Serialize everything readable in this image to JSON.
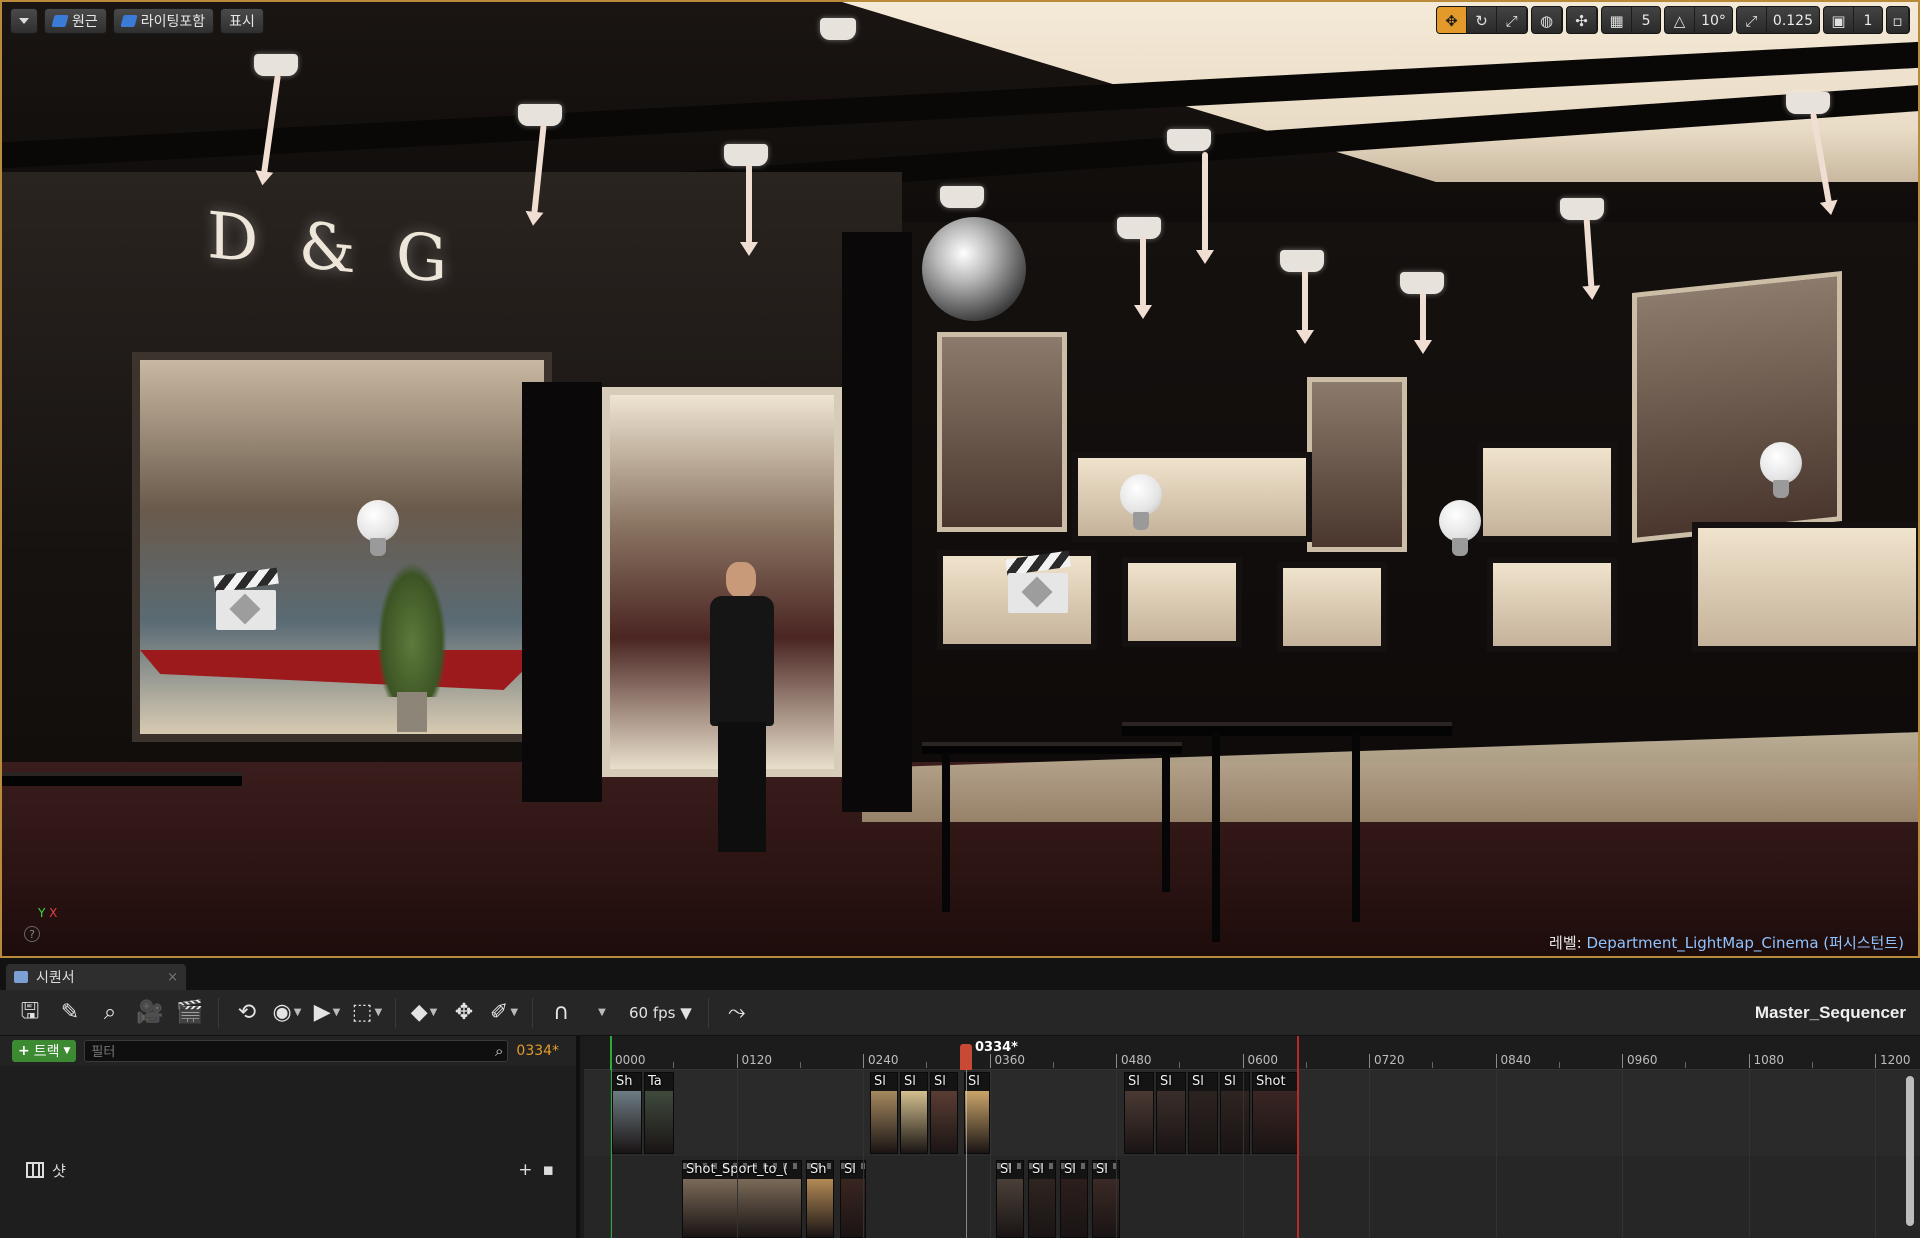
{
  "viewport": {
    "toolbar_left": {
      "menu_label": "",
      "perspective_label": "원근",
      "lighting_label": "라이팅포함",
      "show_label": "표시"
    },
    "toolbar_right": {
      "grid_snap_value": "5",
      "rotation_snap_value": "10°",
      "scale_snap_value": "0.125",
      "camera_speed_value": "1"
    },
    "scene_text": {
      "store_logo": "D & G"
    },
    "level_label_key": "레벨:",
    "level_label_value": "Department_LightMap_Cinema (퍼시스턴트)",
    "axis_y": "Y",
    "axis_x": "X",
    "help_glyph": "?"
  },
  "sequencer": {
    "tab_label": "시퀀서",
    "tab_close": "×",
    "fps_label": "60 fps",
    "sequence_name": "Master_Sequencer",
    "add_track_label": "트랙",
    "filter_placeholder": "필터",
    "current_frame": "0334*",
    "playhead_label": "0334*",
    "shot_track_label": "샷",
    "ruler_ticks": [
      "0000",
      "0120",
      "0240",
      "0360",
      "0480",
      "0600",
      "0720",
      "0840",
      "0960",
      "1080",
      "1200"
    ],
    "clips_row1": [
      {
        "label": "Sh"
      },
      {
        "label": "Ta"
      },
      {
        "label": "Sl"
      },
      {
        "label": "Sl"
      },
      {
        "label": "Sl"
      },
      {
        "label": "Sl"
      },
      {
        "label": "Sl"
      },
      {
        "label": "Sl"
      },
      {
        "label": "Sl"
      },
      {
        "label": "Sl"
      },
      {
        "label": "Shot"
      }
    ],
    "clips_row2": [
      {
        "label": "Shot_Sport_to_("
      },
      {
        "label": "Sh"
      },
      {
        "label": "Sl"
      },
      {
        "label": "Sl"
      },
      {
        "label": "Sl"
      },
      {
        "label": "Sl"
      },
      {
        "label": "Sl"
      }
    ]
  },
  "colors": {
    "accent_orange": "#e39a2b",
    "add_track_green": "#3c8b32",
    "playhead_red": "#c84a35",
    "level_value_blue": "#8fc3ff"
  },
  "icons": {
    "save": "save-icon",
    "edit": "edit-icon",
    "search": "search-icon",
    "camera": "camera-icon",
    "clapper": "clapperboard-icon",
    "loop": "loop-icon",
    "eye": "eye-icon",
    "play": "play-icon",
    "select": "selection-icon",
    "key": "keyframe-icon",
    "transform": "transform-icon",
    "pencil": "pencil-icon",
    "magnet": "magnet-icon",
    "curve": "curve-editor-icon"
  }
}
